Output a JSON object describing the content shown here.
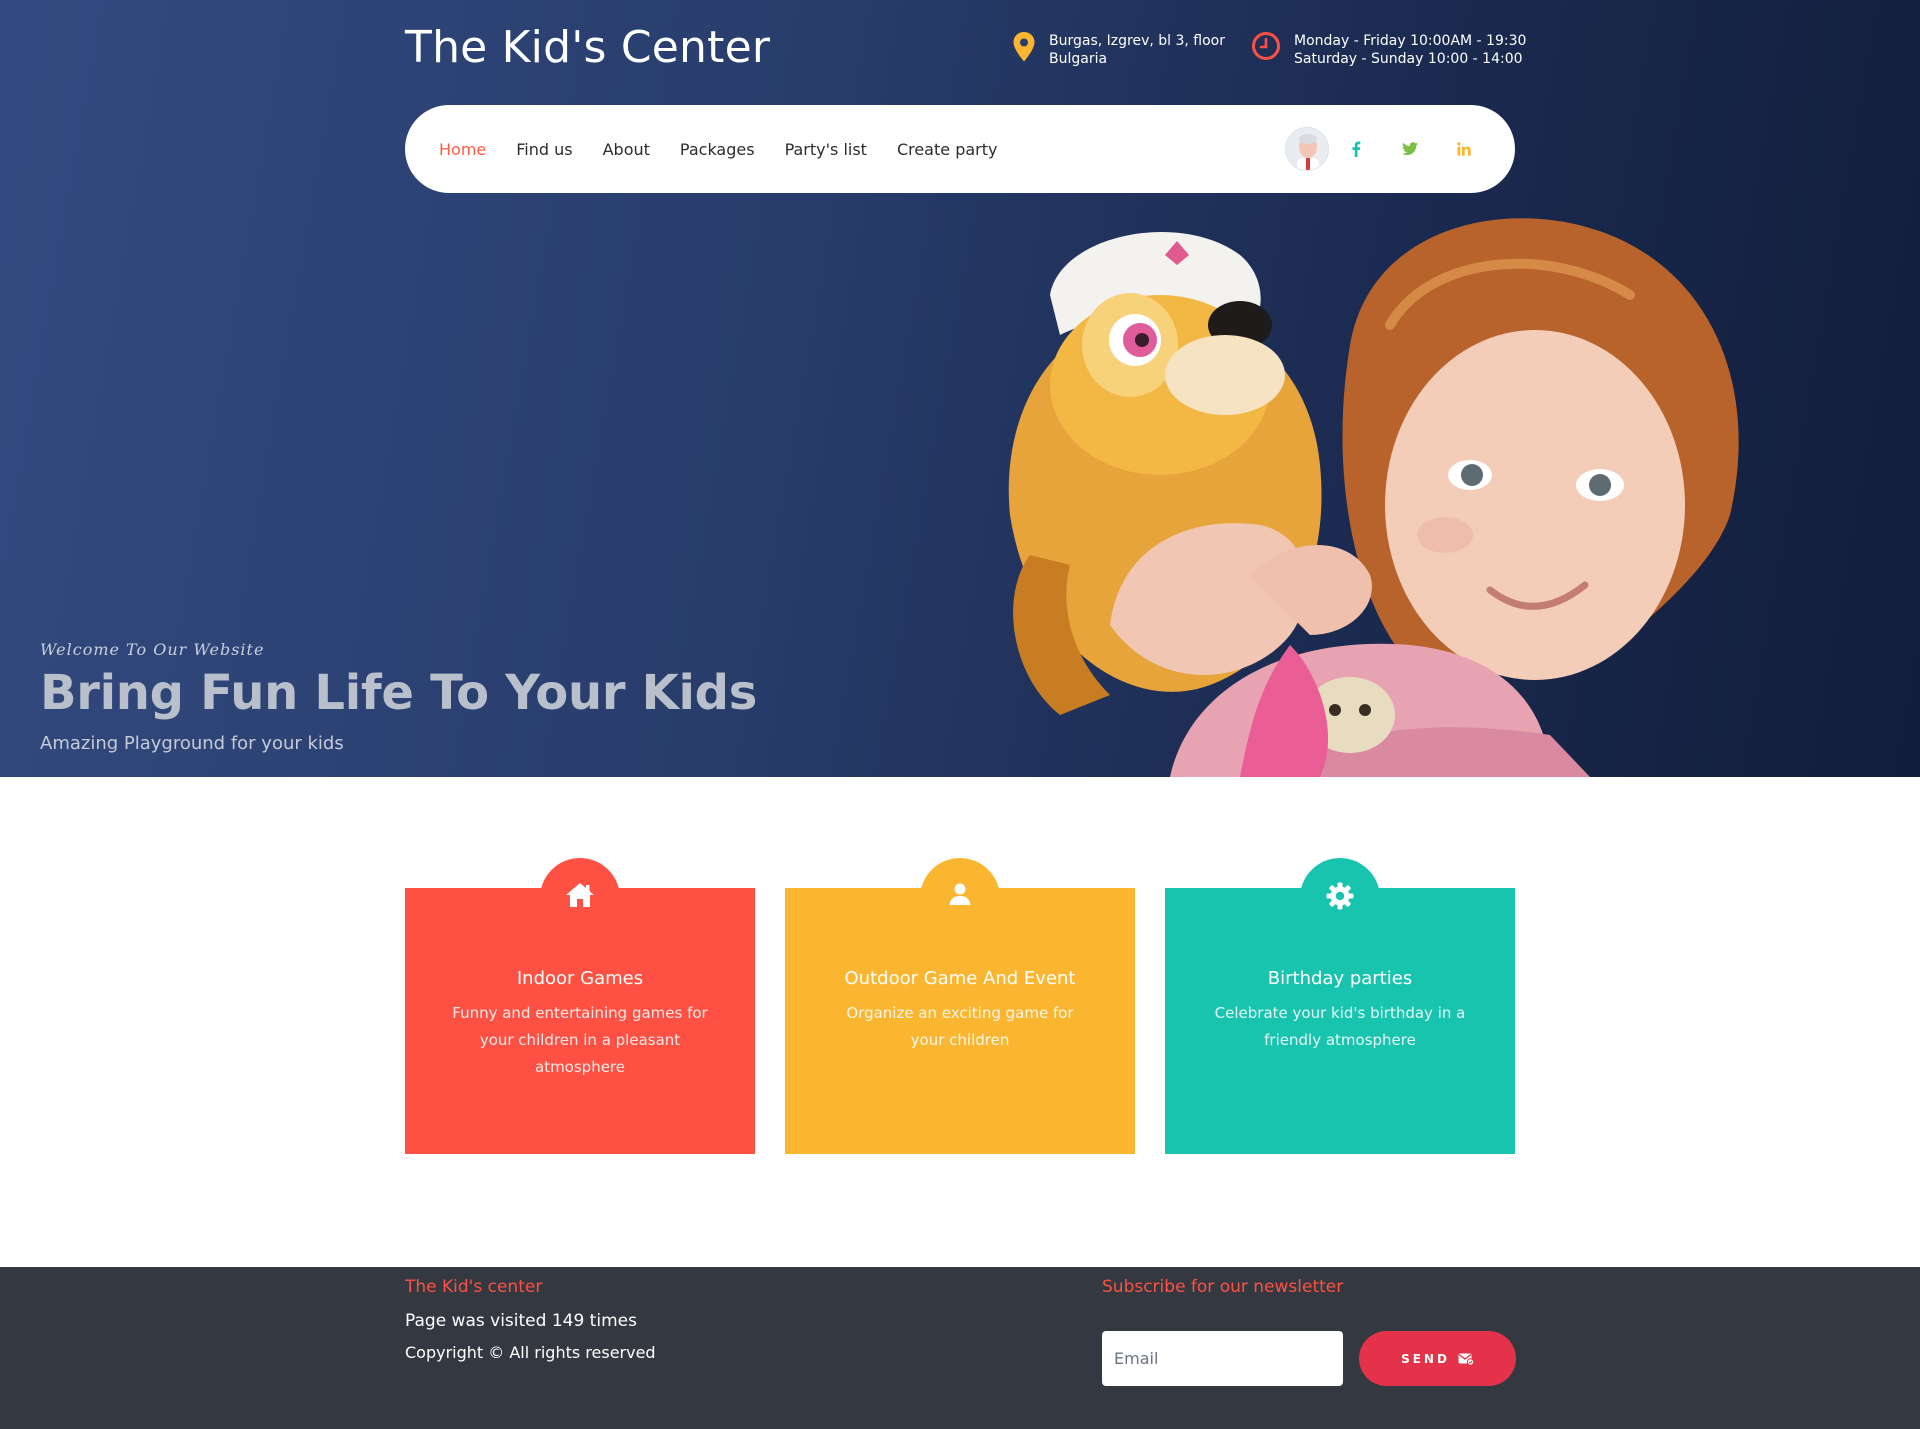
{
  "header": {
    "site_title": "The Kid's Center",
    "address_line1": "Burgas, Izgrev, bl 3, floor",
    "address_line2": "Bulgaria",
    "hours_line1": "Monday - Friday 10:00AM - 19:30",
    "hours_line2": "Saturday - Sunday 10:00 - 14:00",
    "address_icon": "map-pin-icon",
    "hours_icon": "clock-icon"
  },
  "nav": {
    "items": [
      {
        "label": "Home",
        "active": true
      },
      {
        "label": "Find us"
      },
      {
        "label": "About"
      },
      {
        "label": "Packages"
      },
      {
        "label": "Party's list"
      },
      {
        "label": "Create party"
      }
    ],
    "social": [
      "facebook-icon",
      "twitter-icon",
      "linkedin-icon"
    ]
  },
  "hero": {
    "welcome": "Welcome To Our Website",
    "title": "Bring Fun Life To Your Kids",
    "subtitle": "Amazing Playground for your kids"
  },
  "features": [
    {
      "title": "Indoor Games",
      "description": "Funny and entertaining games for your children in a pleasant atmosphere",
      "icon": "home-icon"
    },
    {
      "title": "Outdoor Game And Event",
      "description": "Organize an exciting game for your children",
      "icon": "user-icon"
    },
    {
      "title": "Birthday parties",
      "description": "Celebrate your kid's birthday in a friendly atmosphere",
      "icon": "gear-icon"
    }
  ],
  "footer": {
    "brand": "The Kid's center",
    "visits": "Page was visited 149 times",
    "copyright": "Copyright © All rights reserved",
    "newsletter_title": "Subscribe for our newsletter",
    "email_placeholder": "Email",
    "send_label": "SEND"
  },
  "colors": {
    "accent_red": "#fe5143",
    "accent_yellow": "#fbb631",
    "accent_teal": "#18c4ae",
    "hero_navy": "#283d6c",
    "footer_bg": "#343840",
    "send_button": "#e33249"
  }
}
